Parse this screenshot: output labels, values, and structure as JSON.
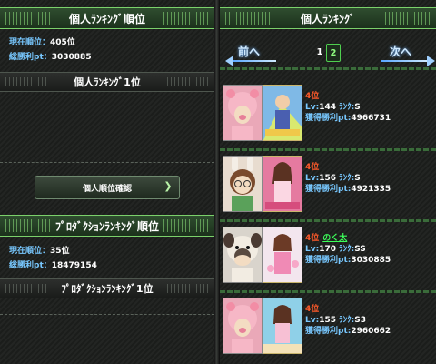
{
  "left": {
    "personal_header": "個人ﾗﾝｷﾝｸﾞ順位",
    "current_rank_label": "現在順位：",
    "current_rank_value": "405位",
    "total_pt_label": "総勝利pt：",
    "total_pt_value": "3030885",
    "personal_top": "個人ﾗﾝｷﾝｸﾞ1位",
    "confirm_button": "個人順位確認",
    "production_header": "ﾌﾟﾛﾀﾞｸｼｮﾝﾗﾝｷﾝｸﾞ順位",
    "prod_rank_label": "現在順位：",
    "prod_rank_value": "35位",
    "prod_pt_label": "総勝利pt：",
    "prod_pt_value": "18479154",
    "production_top": "ﾌﾟﾛﾀﾞｸｼｮﾝﾗﾝｷﾝｸﾞ1位"
  },
  "right": {
    "header": "個人ﾗﾝｷﾝｸﾞ",
    "prev": "前へ",
    "next": "次へ",
    "pages": [
      "1",
      "2"
    ],
    "current_page": "2",
    "rows": [
      {
        "rank": "4位",
        "name": "",
        "lv_label": "Lv:",
        "lv": "144",
        "rank_label": " ﾗﾝｸ:",
        "grade": "S",
        "pt_label": "獲得勝利pt:",
        "pt": "4966731"
      },
      {
        "rank": "4位",
        "name": "",
        "lv_label": "Lv:",
        "lv": "156",
        "rank_label": " ﾗﾝｸ:",
        "grade": "S",
        "pt_label": "獲得勝利pt:",
        "pt": "4921335"
      },
      {
        "rank": "4位",
        "name": "のく太",
        "lv_label": "Lv:",
        "lv": "170",
        "rank_label": " ﾗﾝｸ:",
        "grade": "SS",
        "pt_label": "獲得勝利pt:",
        "pt": "3030885"
      },
      {
        "rank": "4位",
        "name": "",
        "lv_label": "Lv:",
        "lv": "155",
        "rank_label": " ﾗﾝｸ:",
        "grade": "S3",
        "pt_label": "獲得勝利pt:",
        "pt": "2960662"
      }
    ]
  },
  "colors": {
    "accent_green": "#7bd16b",
    "label_blue": "#78c8ff",
    "rank_red": "#ff5a2a",
    "name_green": "#3cff5a"
  },
  "icons": [
    "chevron-right-icon",
    "prev-arrow-icon",
    "next-arrow-icon",
    "pig-avatar-icon",
    "bunny-avatar-icon",
    "pug-avatar-icon"
  ]
}
